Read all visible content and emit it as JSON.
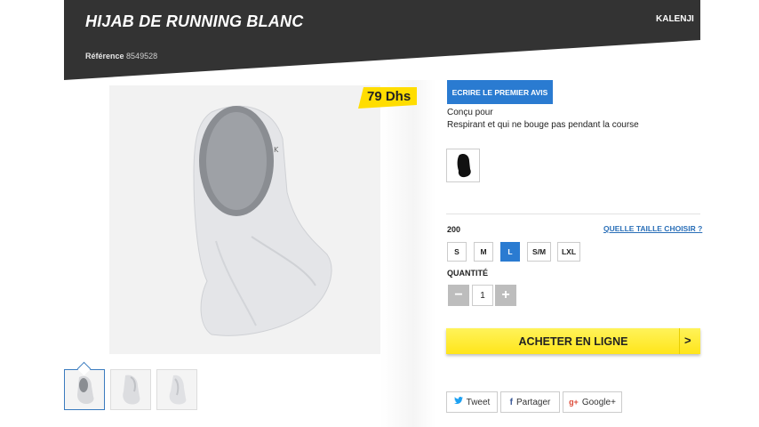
{
  "header": {
    "title": "HIJAB DE RUNNING BLANC",
    "brand": "KALENJI",
    "reference_label": "Référence",
    "reference_value": "8549528"
  },
  "product": {
    "price": "79 Dhs",
    "thumbnails_count": 3
  },
  "panel": {
    "review_button": "ECRIRE LE PREMIER AVIS",
    "description_line1": "Conçu pour",
    "description_line2": "Respirant et qui ne bouge pas pendant la course",
    "size_value": "200",
    "size_guide_link": "QUELLE TAILLE CHOISIR ?",
    "sizes": [
      "S",
      "M",
      "L",
      "S/M",
      "LXL"
    ],
    "selected_size": "L",
    "quantity_label": "QUANTITÉ",
    "quantity_value": "1",
    "quantity_minus": "−",
    "quantity_plus": "+",
    "buy_button": "ACHETER EN LIGNE",
    "buy_arrow": ">"
  },
  "share": {
    "tweet": "Tweet",
    "facebook": "Partager",
    "google": "Google+"
  },
  "colors": {
    "banner": "#333333",
    "accent_blue": "#2a7bd1",
    "buy_yellow": "#ffe51a",
    "price_yellow": "#ffdd00"
  }
}
